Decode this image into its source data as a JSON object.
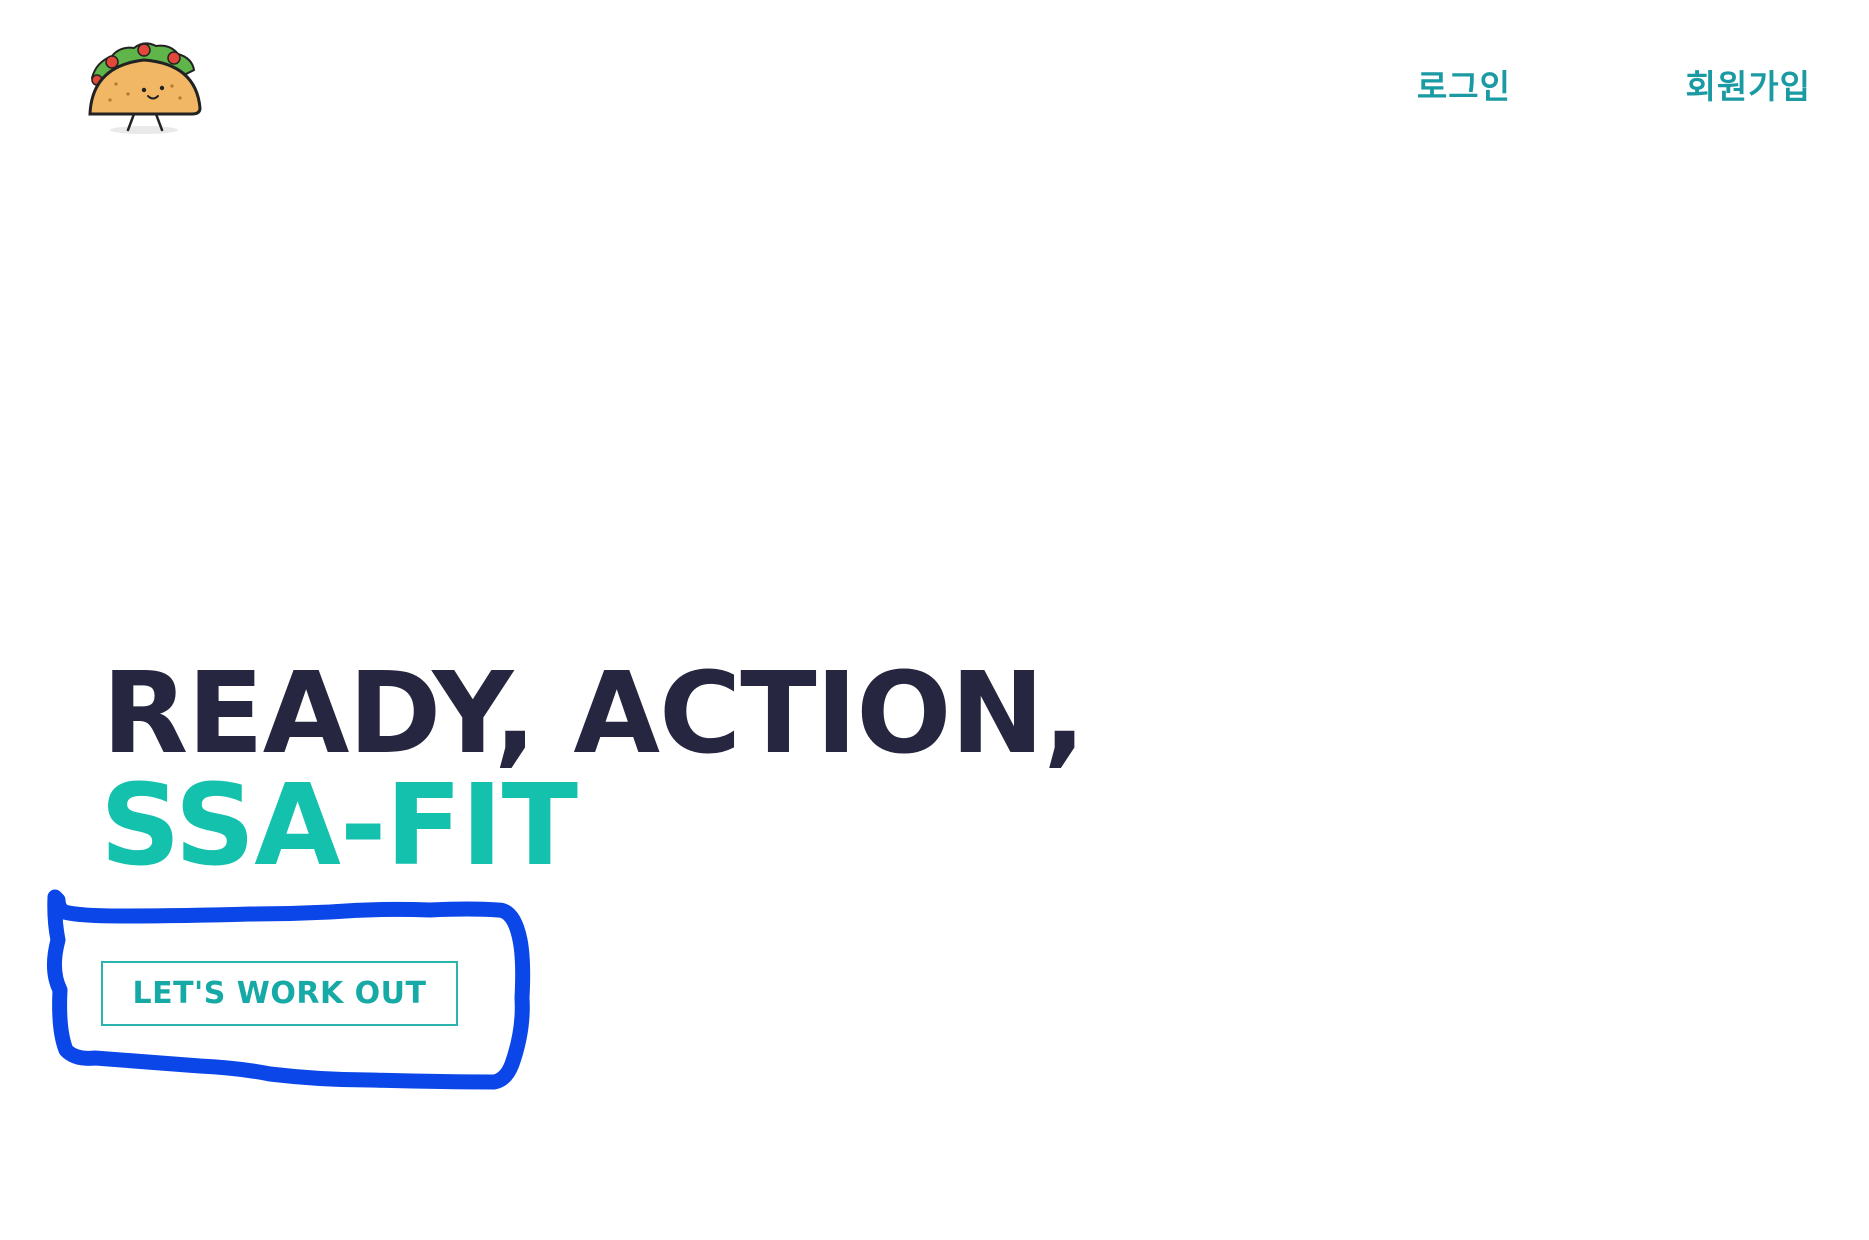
{
  "header": {
    "logo": {
      "icon": "taco-mascot-icon"
    },
    "nav": {
      "login_label": "로그인",
      "signup_label": "회원가입"
    }
  },
  "hero": {
    "headline_line1": "READY, ACTION,",
    "headline_line2": "SSA-FIT",
    "cta_label": "LET'S WORK OUT"
  },
  "colors": {
    "nav_text": "#1a9aa2",
    "headline_dark": "#262640",
    "headline_accent": "#14c1ad",
    "cta_border": "#2bb3ad",
    "annotation_stroke": "#0b46e8"
  }
}
